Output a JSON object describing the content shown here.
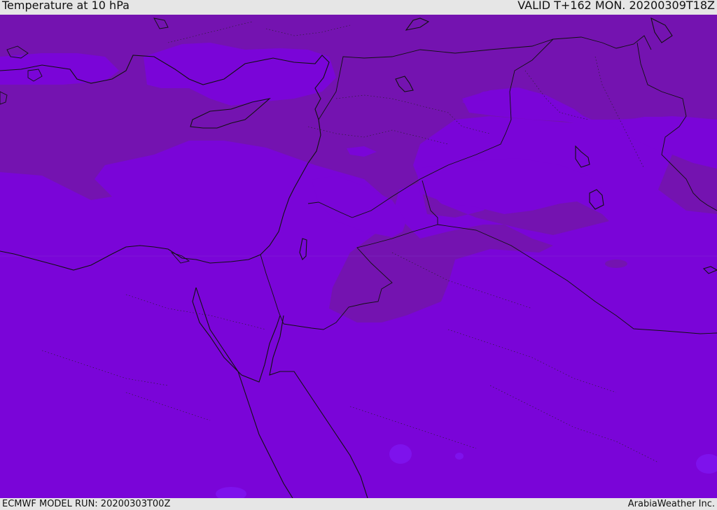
{
  "header": {
    "title": "Temperature at 10 hPa",
    "valid": "VALID T+162 MON. 20200309T18Z"
  },
  "footer": {
    "model_run": "ECMWF MODEL RUN: 20200303T00Z",
    "credit": "ArabiaWeather Inc."
  },
  "map": {
    "colors": {
      "warm_band": "#7413b0",
      "cool_band": "#7a05d8",
      "coldest_patch": "#7e12ec",
      "coastline": "#111111"
    }
  }
}
